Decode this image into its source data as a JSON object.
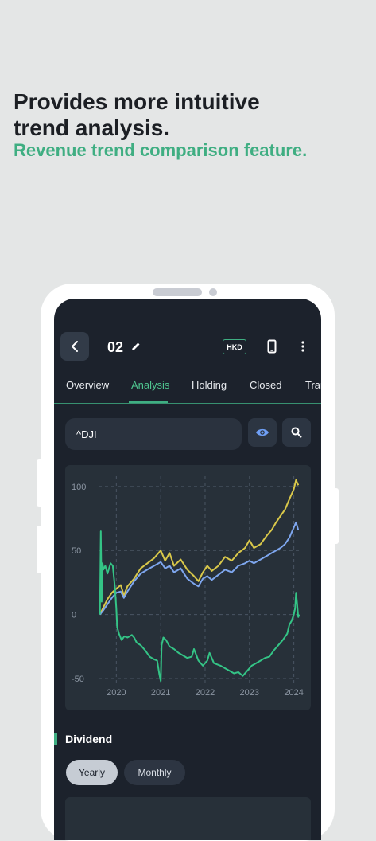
{
  "promo": {
    "headline_line1": "Provides more intuitive",
    "headline_line2": "trend analysis.",
    "subheadline": "Revenue trend comparison feature."
  },
  "header": {
    "portfolio_name": "02",
    "currency_badge": "HKD",
    "icons": [
      "chevron-left-icon",
      "pencil-icon",
      "phone-icon",
      "more-vertical-icon"
    ]
  },
  "tabs": [
    {
      "label": "Overview"
    },
    {
      "label": "Analysis",
      "active": true
    },
    {
      "label": "Holding"
    },
    {
      "label": "Closed"
    },
    {
      "label": "Tran"
    }
  ],
  "search": {
    "ticker": "^DJI",
    "icons": [
      "eye-icon",
      "search-icon"
    ]
  },
  "dividend": {
    "title": "Dividend",
    "yearly_label": "Yearly",
    "monthly_label": "Monthly",
    "selected": "Yearly"
  },
  "colors": {
    "accent": "#3fae82",
    "series_yellow": "#d9c84a",
    "series_blue": "#7ea6ee",
    "series_green": "#34c486"
  },
  "chart_data": {
    "type": "line",
    "ylim": [
      -55,
      108
    ],
    "y_ticks": [
      100,
      50,
      0,
      -50
    ],
    "x_ticks": [
      2020,
      2021,
      2022,
      2023,
      2024
    ],
    "xlim": [
      2019.6,
      2024.15
    ],
    "grid": true,
    "series": [
      {
        "color": "#d9c84a",
        "points": [
          [
            2019.63,
            0
          ],
          [
            2019.7,
            5
          ],
          [
            2019.8,
            12
          ],
          [
            2019.9,
            17
          ],
          [
            2020.0,
            20
          ],
          [
            2020.1,
            23
          ],
          [
            2020.17,
            15
          ],
          [
            2020.25,
            22
          ],
          [
            2020.4,
            28
          ],
          [
            2020.55,
            36
          ],
          [
            2020.7,
            40
          ],
          [
            2020.85,
            44
          ],
          [
            2021.0,
            50
          ],
          [
            2021.1,
            42
          ],
          [
            2021.2,
            48
          ],
          [
            2021.3,
            38
          ],
          [
            2021.45,
            43
          ],
          [
            2021.6,
            35
          ],
          [
            2021.75,
            30
          ],
          [
            2021.85,
            26
          ],
          [
            2021.95,
            33
          ],
          [
            2022.05,
            38
          ],
          [
            2022.15,
            34
          ],
          [
            2022.3,
            38
          ],
          [
            2022.45,
            45
          ],
          [
            2022.6,
            42
          ],
          [
            2022.75,
            48
          ],
          [
            2022.9,
            52
          ],
          [
            2023.0,
            58
          ],
          [
            2023.1,
            52
          ],
          [
            2023.25,
            55
          ],
          [
            2023.4,
            62
          ],
          [
            2023.5,
            66
          ],
          [
            2023.6,
            72
          ],
          [
            2023.7,
            77
          ],
          [
            2023.8,
            82
          ],
          [
            2023.9,
            90
          ],
          [
            2024.0,
            98
          ],
          [
            2024.05,
            105
          ],
          [
            2024.1,
            101
          ]
        ]
      },
      {
        "color": "#7ea6ee",
        "points": [
          [
            2019.63,
            0
          ],
          [
            2019.7,
            3
          ],
          [
            2019.8,
            8
          ],
          [
            2019.9,
            13
          ],
          [
            2020.0,
            17
          ],
          [
            2020.1,
            18
          ],
          [
            2020.17,
            13
          ],
          [
            2020.25,
            18
          ],
          [
            2020.4,
            26
          ],
          [
            2020.55,
            32
          ],
          [
            2020.7,
            35
          ],
          [
            2020.85,
            38
          ],
          [
            2021.0,
            41
          ],
          [
            2021.1,
            36
          ],
          [
            2021.2,
            38
          ],
          [
            2021.3,
            33
          ],
          [
            2021.45,
            36
          ],
          [
            2021.6,
            28
          ],
          [
            2021.75,
            24
          ],
          [
            2021.85,
            22
          ],
          [
            2021.95,
            28
          ],
          [
            2022.05,
            30
          ],
          [
            2022.15,
            27
          ],
          [
            2022.3,
            31
          ],
          [
            2022.45,
            35
          ],
          [
            2022.6,
            33
          ],
          [
            2022.75,
            38
          ],
          [
            2022.9,
            40
          ],
          [
            2023.0,
            42
          ],
          [
            2023.1,
            40
          ],
          [
            2023.25,
            43
          ],
          [
            2023.4,
            46
          ],
          [
            2023.5,
            48
          ],
          [
            2023.6,
            50
          ],
          [
            2023.7,
            52
          ],
          [
            2023.8,
            55
          ],
          [
            2023.9,
            60
          ],
          [
            2024.0,
            68
          ],
          [
            2024.05,
            72
          ],
          [
            2024.1,
            66
          ]
        ]
      },
      {
        "color": "#34c486",
        "points": [
          [
            2019.63,
            0
          ],
          [
            2019.65,
            65
          ],
          [
            2019.67,
            10
          ],
          [
            2019.69,
            40
          ],
          [
            2019.71,
            35
          ],
          [
            2019.75,
            38
          ],
          [
            2019.8,
            32
          ],
          [
            2019.87,
            40
          ],
          [
            2019.92,
            38
          ],
          [
            2019.97,
            20
          ],
          [
            2020.0,
            5
          ],
          [
            2020.02,
            -10
          ],
          [
            2020.06,
            -15
          ],
          [
            2020.12,
            -20
          ],
          [
            2020.18,
            -17
          ],
          [
            2020.25,
            -18
          ],
          [
            2020.35,
            -16
          ],
          [
            2020.4,
            -18
          ],
          [
            2020.46,
            -22
          ],
          [
            2020.55,
            -24
          ],
          [
            2020.65,
            -28
          ],
          [
            2020.75,
            -33
          ],
          [
            2020.85,
            -35
          ],
          [
            2020.92,
            -36
          ],
          [
            2020.97,
            -47
          ],
          [
            2021.0,
            -52
          ],
          [
            2021.02,
            -24
          ],
          [
            2021.06,
            -18
          ],
          [
            2021.12,
            -20
          ],
          [
            2021.2,
            -25
          ],
          [
            2021.3,
            -27
          ],
          [
            2021.4,
            -30
          ],
          [
            2021.5,
            -32
          ],
          [
            2021.6,
            -34
          ],
          [
            2021.7,
            -33
          ],
          [
            2021.75,
            -27
          ],
          [
            2021.85,
            -36
          ],
          [
            2021.95,
            -40
          ],
          [
            2022.05,
            -36
          ],
          [
            2022.1,
            -30
          ],
          [
            2022.2,
            -38
          ],
          [
            2022.35,
            -40
          ],
          [
            2022.45,
            -42
          ],
          [
            2022.55,
            -44
          ],
          [
            2022.65,
            -46
          ],
          [
            2022.75,
            -45
          ],
          [
            2022.85,
            -48
          ],
          [
            2022.95,
            -44
          ],
          [
            2023.05,
            -40
          ],
          [
            2023.15,
            -38
          ],
          [
            2023.25,
            -36
          ],
          [
            2023.35,
            -34
          ],
          [
            2023.45,
            -33
          ],
          [
            2023.55,
            -28
          ],
          [
            2023.65,
            -24
          ],
          [
            2023.75,
            -20
          ],
          [
            2023.85,
            -15
          ],
          [
            2023.9,
            -8
          ],
          [
            2023.95,
            -5
          ],
          [
            2024.0,
            0
          ],
          [
            2024.03,
            5
          ],
          [
            2024.05,
            17
          ],
          [
            2024.07,
            10
          ],
          [
            2024.1,
            -2
          ],
          [
            2024.12,
            0
          ]
        ]
      }
    ]
  }
}
